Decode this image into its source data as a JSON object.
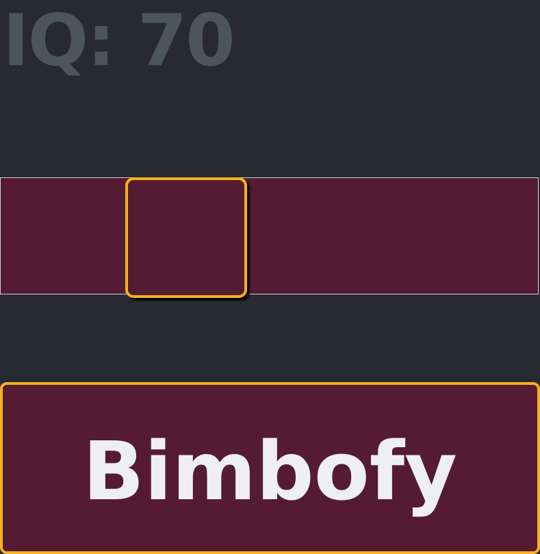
{
  "iq": {
    "label": "IQ: 70",
    "value": 70
  },
  "slider": {
    "value_fraction": 0.3
  },
  "button": {
    "label": "Bimbofy"
  },
  "colors": {
    "background": "#282a31",
    "iq_text": "#4c5559",
    "panel_fill": "#541b33",
    "accent_border": "#f7b21c",
    "button_text": "#eeeff1"
  }
}
